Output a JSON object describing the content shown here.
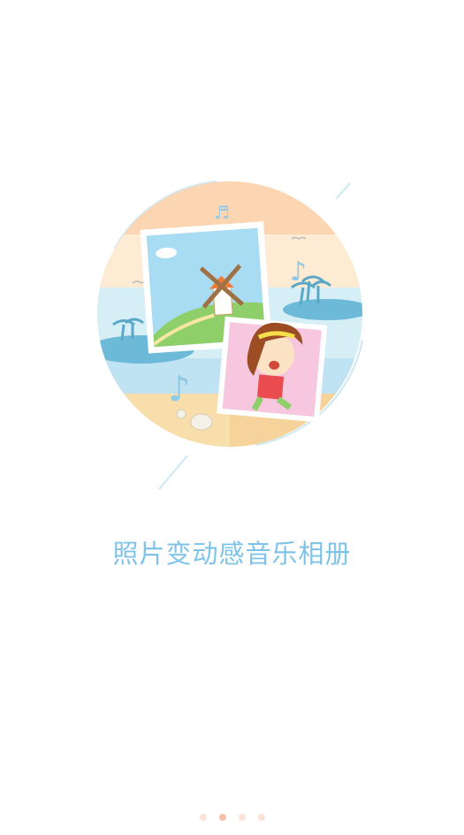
{
  "slide": {
    "tagline": "照片变动感音乐相册"
  },
  "pager": {
    "count": 4,
    "active_index": 1
  },
  "colors": {
    "tagline": "#7fc4e8",
    "dot": "#fbe3d8",
    "dot_active": "#f6c1ab"
  }
}
